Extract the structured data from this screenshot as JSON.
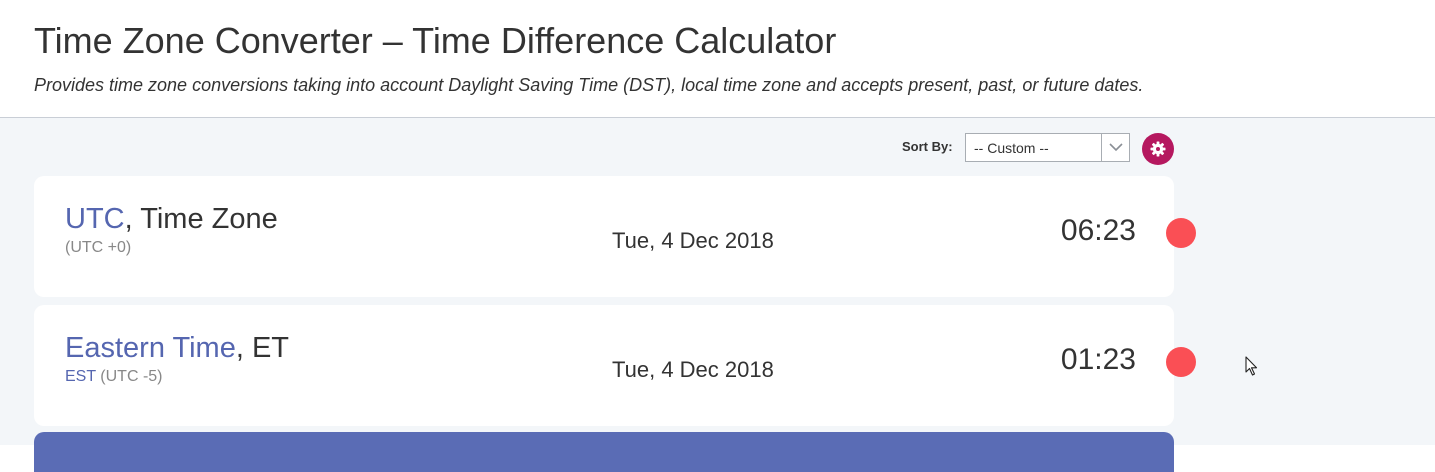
{
  "header": {
    "title": "Time Zone Converter – Time Difference Calculator",
    "subtitle": "Provides time zone conversions taking into account Daylight Saving Time (DST), local time zone and accepts present, past, or future dates."
  },
  "toolbar": {
    "sort_label": "Sort By:",
    "sort_value": "-- Custom --",
    "settings_icon": "gear-icon"
  },
  "zones": [
    {
      "link": "UTC",
      "suffix": ", Time Zone",
      "abbr": "",
      "offset": "(UTC +0)",
      "date": "Tue, 4 Dec 2018",
      "time": "06:23"
    },
    {
      "link": "Eastern Time",
      "suffix": ", ET",
      "abbr": "EST",
      "offset": "(UTC -5)",
      "date": "Tue, 4 Dec 2018",
      "time": "01:23"
    }
  ],
  "colors": {
    "accent": "#5566b0",
    "settings": "#b5185f",
    "remove": "#fa4f55",
    "add_bar": "#5a6cb5"
  }
}
